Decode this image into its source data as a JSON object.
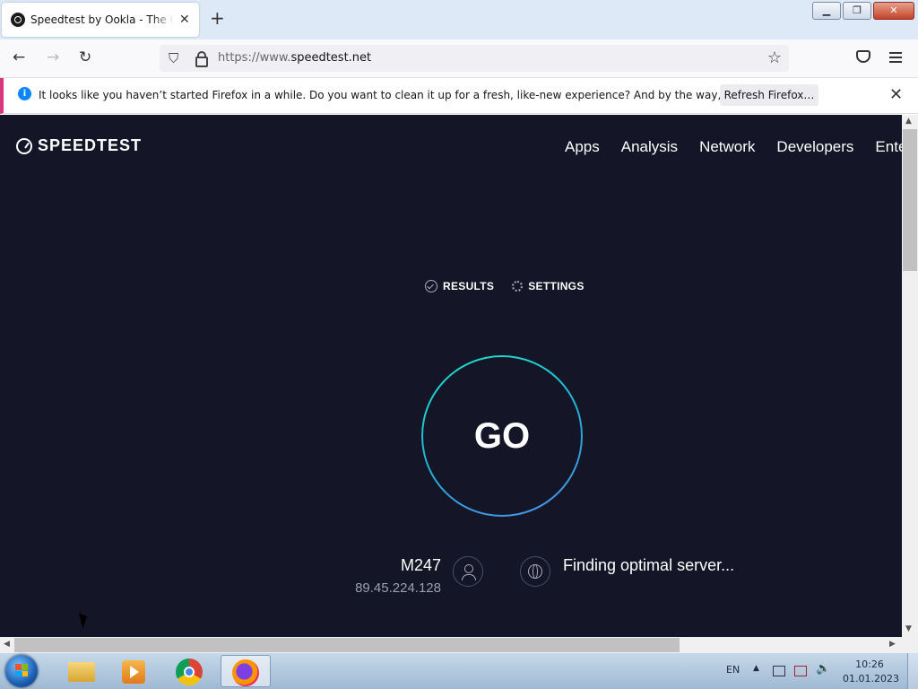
{
  "browser": {
    "tab": {
      "title": "Speedtest by Ookla - The Global Broadband Speed Test",
      "close": "✕"
    },
    "new_tab": "+",
    "url": {
      "prefix": "https://www.",
      "domain": "speedtest.net"
    },
    "window_buttons": {
      "minimize": "▁",
      "maximize": "❐",
      "close": "✕"
    }
  },
  "notification": {
    "text": "It looks like you haven’t started Firefox in a while. Do you want to clean it up for a fresh, like-new experience? And by the way, welcome back!",
    "button": "Refresh Firefox…",
    "close": "✕"
  },
  "page": {
    "logo": "SPEEDTEST",
    "nav": [
      "Apps",
      "Analysis",
      "Network",
      "Developers",
      "Enterprise"
    ],
    "links": {
      "results": "RESULTS",
      "settings": "SETTINGS"
    },
    "go": "GO",
    "isp": {
      "name": "M247",
      "ip": "89.45.224.128"
    },
    "server_status": "Finding optimal server..."
  },
  "taskbar": {
    "language": "EN",
    "time": "10:26",
    "date": "01.01.2023"
  },
  "colors": {
    "page_bg": "#141526",
    "ring_start": "#1ee0c8",
    "ring_end": "#4f8fe8",
    "notification_accent": "#d9377d"
  }
}
